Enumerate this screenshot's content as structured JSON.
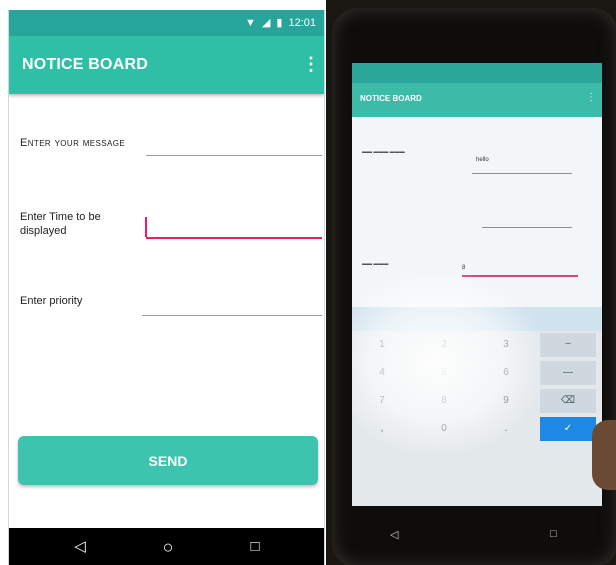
{
  "left": {
    "status_time": "12:01",
    "app_title": "NOTICE BOARD",
    "menu_glyph": "⋮",
    "fields": [
      {
        "label": "Enter your message",
        "value": ""
      },
      {
        "label": "Enter Time to be displayed",
        "value": ""
      },
      {
        "label": "Enter priority",
        "value": ""
      }
    ],
    "send_label": "SEND",
    "nav": {
      "back": "◁",
      "home": "○",
      "recents": "□"
    }
  },
  "right": {
    "app_title": "NOTICE BOARD",
    "field_1_value": "hello",
    "field_3_value": "8",
    "keys": [
      "1",
      "2",
      "3",
      "−",
      "4",
      "5",
      "6",
      "—",
      "7",
      "8",
      "9",
      "⌫",
      ",",
      "0",
      ".",
      "✓"
    ],
    "nav": {
      "back": "◁",
      "recents": "□"
    }
  },
  "colors": {
    "primary": "#2fbfa6",
    "primary_dark": "#26a69a",
    "accent": "#e91e63",
    "button": "#3cc4ae"
  },
  "icons": [
    "wifi-icon",
    "signal-icon",
    "battery-icon",
    "overflow-menu-icon",
    "back-icon",
    "home-icon",
    "recents-icon"
  ]
}
